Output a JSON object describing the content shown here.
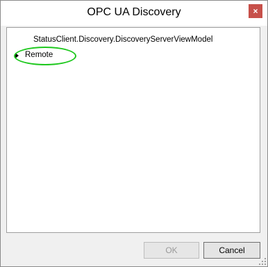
{
  "window": {
    "title": "OPC UA Discovery",
    "close_icon": "close-icon",
    "close_glyph": "×",
    "close_color": "#c7504a"
  },
  "tree": {
    "header": "StatusClient.Discovery.DiscoveryServerViewModel",
    "items": [
      {
        "label": "Remote",
        "expanded": false,
        "icon": "chevron-right-icon",
        "highlighted": true,
        "highlight_color": "#1ec81e"
      }
    ]
  },
  "buttons": {
    "ok_label": "OK",
    "ok_enabled": false,
    "cancel_label": "Cancel"
  },
  "resize_grip_icon": "resize-grip-icon"
}
